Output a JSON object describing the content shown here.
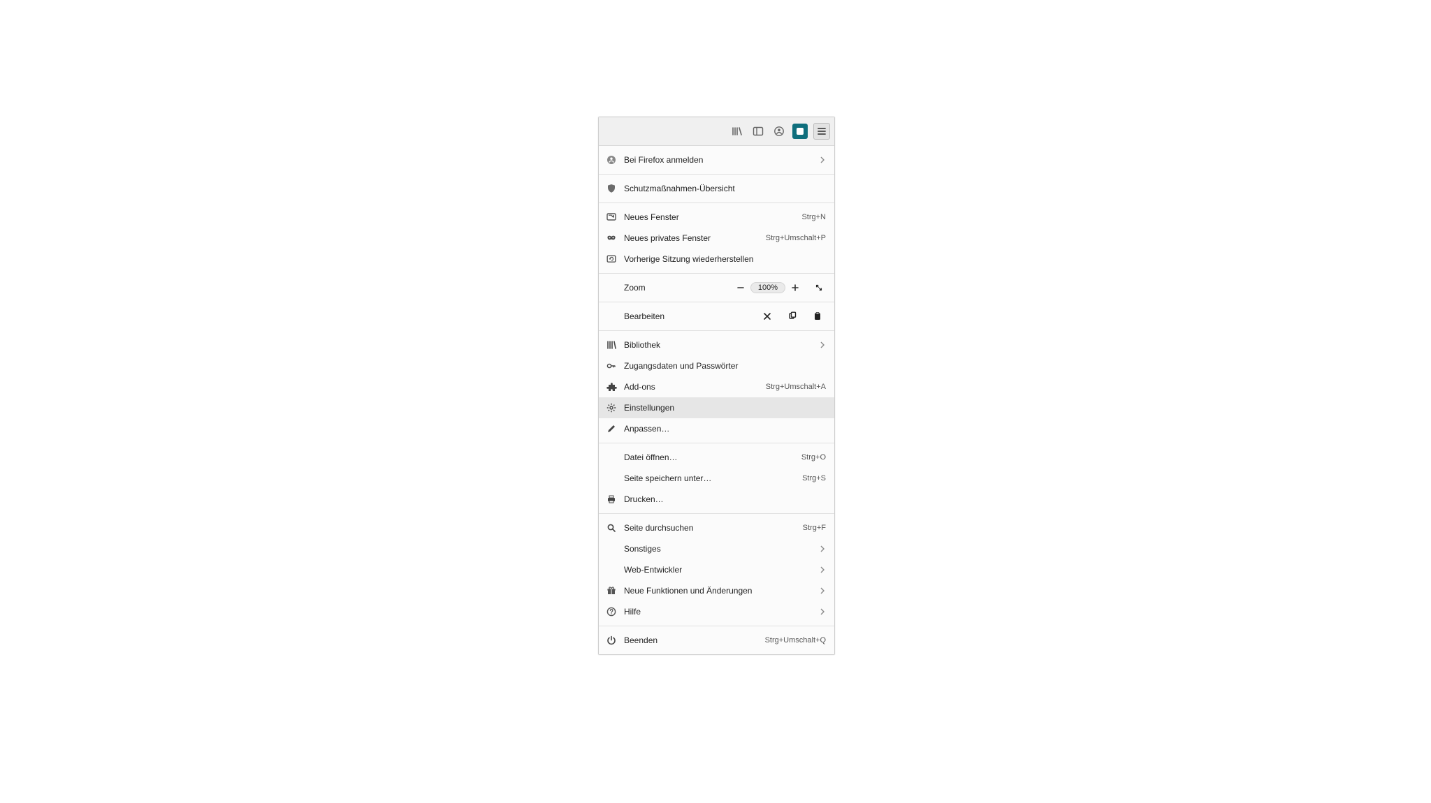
{
  "toolbar": {
    "icons": [
      "library",
      "sidebar",
      "account",
      "addon",
      "hamburger"
    ]
  },
  "menu": {
    "signin": {
      "label": "Bei Firefox anmelden"
    },
    "protections": {
      "label": "Schutzmaßnahmen-Übersicht"
    },
    "new_window": {
      "label": "Neues Fenster",
      "shortcut": "Strg+N"
    },
    "new_private": {
      "label": "Neues privates Fenster",
      "shortcut": "Strg+Umschalt+P"
    },
    "restore_session": {
      "label": "Vorherige Sitzung wiederherstellen"
    },
    "zoom": {
      "label": "Zoom",
      "value": "100%"
    },
    "edit": {
      "label": "Bearbeiten"
    },
    "library": {
      "label": "Bibliothek"
    },
    "logins": {
      "label": "Zugangsdaten und Passwörter"
    },
    "addons": {
      "label": "Add-ons",
      "shortcut": "Strg+Umschalt+A"
    },
    "settings": {
      "label": "Einstellungen"
    },
    "customize": {
      "label": "Anpassen…"
    },
    "open_file": {
      "label": "Datei öffnen…",
      "shortcut": "Strg+O"
    },
    "save_page": {
      "label": "Seite speichern unter…",
      "shortcut": "Strg+S"
    },
    "print": {
      "label": "Drucken…"
    },
    "find": {
      "label": "Seite durchsuchen",
      "shortcut": "Strg+F"
    },
    "other": {
      "label": "Sonstiges"
    },
    "devtools": {
      "label": "Web-Entwickler"
    },
    "whatsnew": {
      "label": "Neue Funktionen und Änderungen"
    },
    "help": {
      "label": "Hilfe"
    },
    "quit": {
      "label": "Beenden",
      "shortcut": "Strg+Umschalt+Q"
    }
  }
}
